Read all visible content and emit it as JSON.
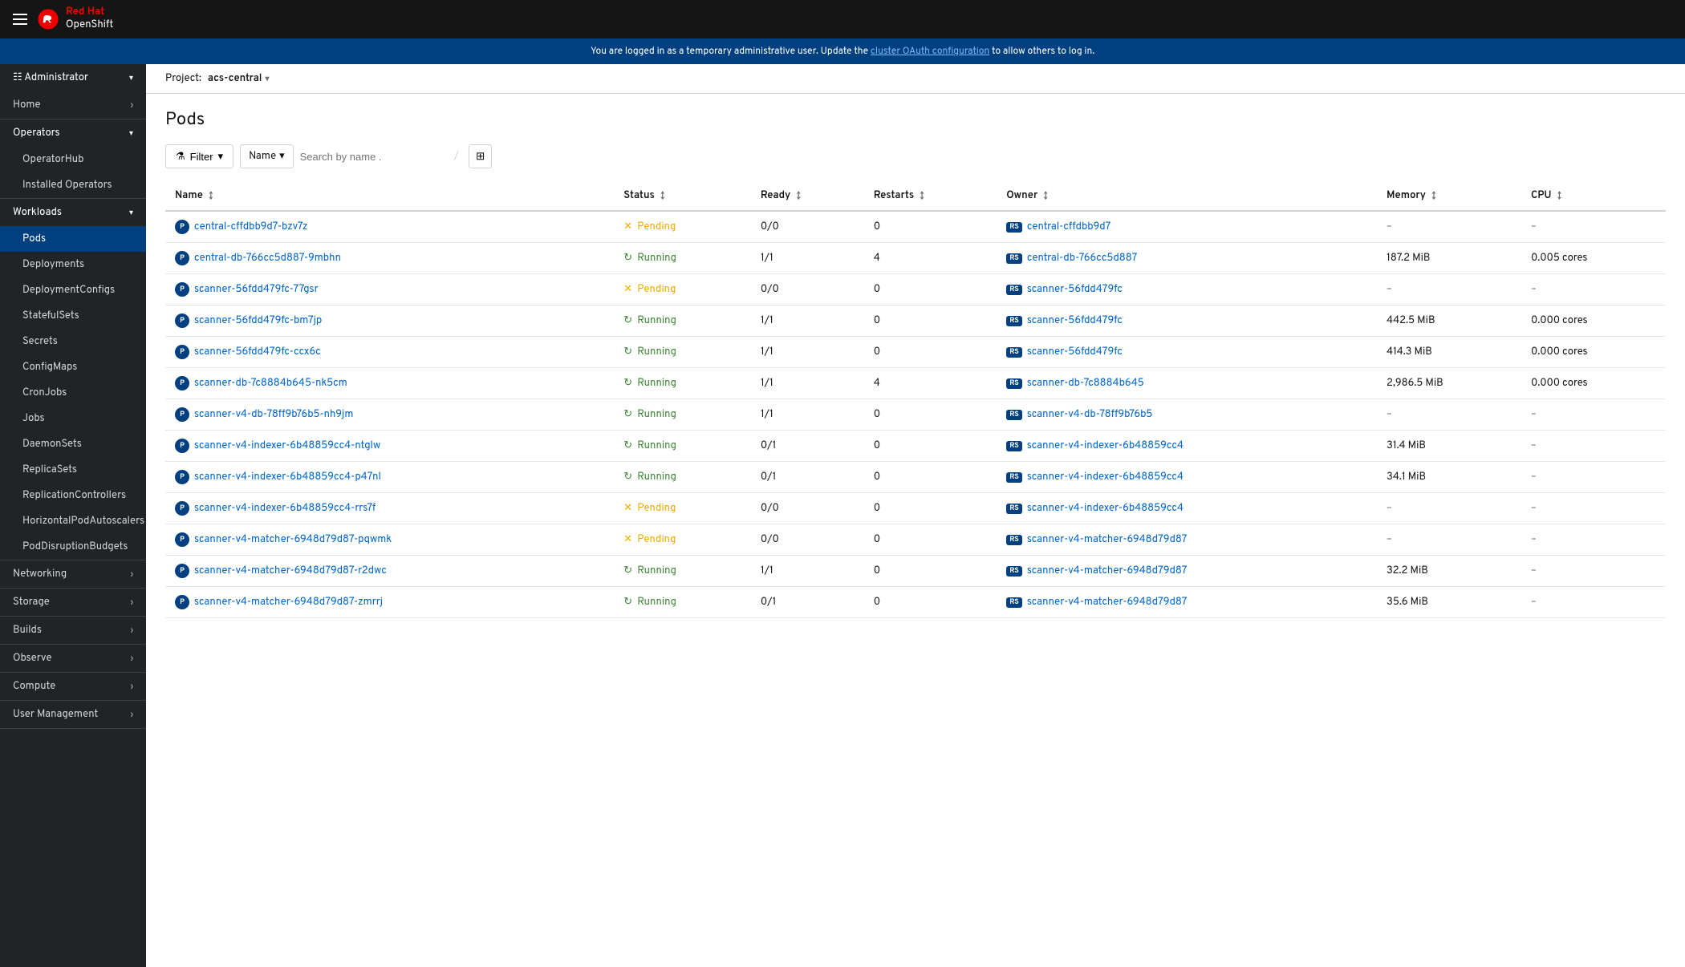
{
  "topbar": {
    "brand_red": "Red Hat",
    "brand_name": "OpenShift"
  },
  "notice": {
    "text": "You are logged in as a temporary administrative user. Update the ",
    "link_text": "cluster OAuth configuration",
    "text_after": " to allow others to log in."
  },
  "sidebar": {
    "role_label": "Administrator",
    "sections": [
      {
        "label": "Home",
        "has_children": true,
        "expanded": false
      },
      {
        "label": "Operators",
        "has_children": true,
        "expanded": true,
        "children": [
          "OperatorHub",
          "Installed Operators"
        ]
      },
      {
        "label": "Workloads",
        "has_children": true,
        "expanded": true,
        "children": [
          "Pods",
          "Deployments",
          "DeploymentConfigs",
          "StatefulSets",
          "Secrets",
          "ConfigMaps",
          "CronJobs",
          "Jobs",
          "DaemonSets",
          "ReplicaSets",
          "ReplicationControllers",
          "HorizontalPodAutoscalers",
          "PodDisruptionBudgets"
        ]
      },
      {
        "label": "Networking",
        "has_children": true,
        "expanded": false
      },
      {
        "label": "Storage",
        "has_children": true,
        "expanded": false
      },
      {
        "label": "Builds",
        "has_children": true,
        "expanded": false
      },
      {
        "label": "Observe",
        "has_children": true,
        "expanded": false
      },
      {
        "label": "Compute",
        "has_children": true,
        "expanded": false
      },
      {
        "label": "User Management",
        "has_children": true,
        "expanded": false
      }
    ]
  },
  "project": {
    "label": "Project:",
    "name": "acs-central"
  },
  "page": {
    "title": "Pods"
  },
  "filter": {
    "filter_label": "Filter",
    "name_label": "Name",
    "search_placeholder": "Search by name ."
  },
  "table": {
    "columns": [
      "Name",
      "Status",
      "Ready",
      "Restarts",
      "Owner",
      "Memory",
      "CPU"
    ],
    "rows": [
      {
        "name": "central-cffdbb9d7-bzv7z",
        "status": "Pending",
        "status_type": "pending",
        "ready": "0/0",
        "restarts": "0",
        "owner": "central-cffdbb9d7",
        "owner_badge": "RS",
        "memory": "–",
        "cpu": "–"
      },
      {
        "name": "central-db-766cc5d887-9mbhn",
        "status": "Running",
        "status_type": "running",
        "ready": "1/1",
        "restarts": "4",
        "owner": "central-db-766cc5d887",
        "owner_badge": "RS",
        "memory": "187.2 MiB",
        "cpu": "0.005 cores"
      },
      {
        "name": "scanner-56fdd479fc-77gsr",
        "status": "Pending",
        "status_type": "pending",
        "ready": "0/0",
        "restarts": "0",
        "owner": "scanner-56fdd479fc",
        "owner_badge": "RS",
        "memory": "–",
        "cpu": "–"
      },
      {
        "name": "scanner-56fdd479fc-bm7jp",
        "status": "Running",
        "status_type": "running",
        "ready": "1/1",
        "restarts": "0",
        "owner": "scanner-56fdd479fc",
        "owner_badge": "RS",
        "memory": "442.5 MiB",
        "cpu": "0.000 cores"
      },
      {
        "name": "scanner-56fdd479fc-ccx6c",
        "status": "Running",
        "status_type": "running",
        "ready": "1/1",
        "restarts": "0",
        "owner": "scanner-56fdd479fc",
        "owner_badge": "RS",
        "memory": "414.3 MiB",
        "cpu": "0.000 cores"
      },
      {
        "name": "scanner-db-7c8884b645-nk5cm",
        "status": "Running",
        "status_type": "running",
        "ready": "1/1",
        "restarts": "4",
        "owner": "scanner-db-7c8884b645",
        "owner_badge": "RS",
        "memory": "2,986.5 MiB",
        "cpu": "0.000 cores"
      },
      {
        "name": "scanner-v4-db-78ff9b76b5-nh9jm",
        "status": "Running",
        "status_type": "running",
        "ready": "1/1",
        "restarts": "0",
        "owner": "scanner-v4-db-78ff9b76b5",
        "owner_badge": "RS",
        "memory": "–",
        "cpu": "–"
      },
      {
        "name": "scanner-v4-indexer-6b48859cc4-ntglw",
        "status": "Running",
        "status_type": "running",
        "ready": "0/1",
        "restarts": "0",
        "owner": "scanner-v4-indexer-6b48859cc4",
        "owner_badge": "RS",
        "memory": "31.4 MiB",
        "cpu": "–"
      },
      {
        "name": "scanner-v4-indexer-6b48859cc4-p47nl",
        "status": "Running",
        "status_type": "running",
        "ready": "0/1",
        "restarts": "0",
        "owner": "scanner-v4-indexer-6b48859cc4",
        "owner_badge": "RS",
        "memory": "34.1 MiB",
        "cpu": "–"
      },
      {
        "name": "scanner-v4-indexer-6b48859cc4-rrs7f",
        "status": "Pending",
        "status_type": "pending",
        "ready": "0/0",
        "restarts": "0",
        "owner": "scanner-v4-indexer-6b48859cc4",
        "owner_badge": "RS",
        "memory": "–",
        "cpu": "–"
      },
      {
        "name": "scanner-v4-matcher-6948d79d87-pqwmk",
        "status": "Pending",
        "status_type": "pending",
        "ready": "0/0",
        "restarts": "0",
        "owner": "scanner-v4-matcher-6948d79d87",
        "owner_badge": "RS",
        "memory": "–",
        "cpu": "–"
      },
      {
        "name": "scanner-v4-matcher-6948d79d87-r2dwc",
        "status": "Running",
        "status_type": "running",
        "ready": "1/1",
        "restarts": "0",
        "owner": "scanner-v4-matcher-6948d79d87",
        "owner_badge": "RS",
        "memory": "32.2 MiB",
        "cpu": "–"
      },
      {
        "name": "scanner-v4-matcher-6948d79d87-zmrrj",
        "status": "Running",
        "status_type": "running",
        "ready": "0/1",
        "restarts": "0",
        "owner": "scanner-v4-matcher-6948d79d87",
        "owner_badge": "RS",
        "memory": "35.6 MiB",
        "cpu": "–"
      }
    ]
  }
}
